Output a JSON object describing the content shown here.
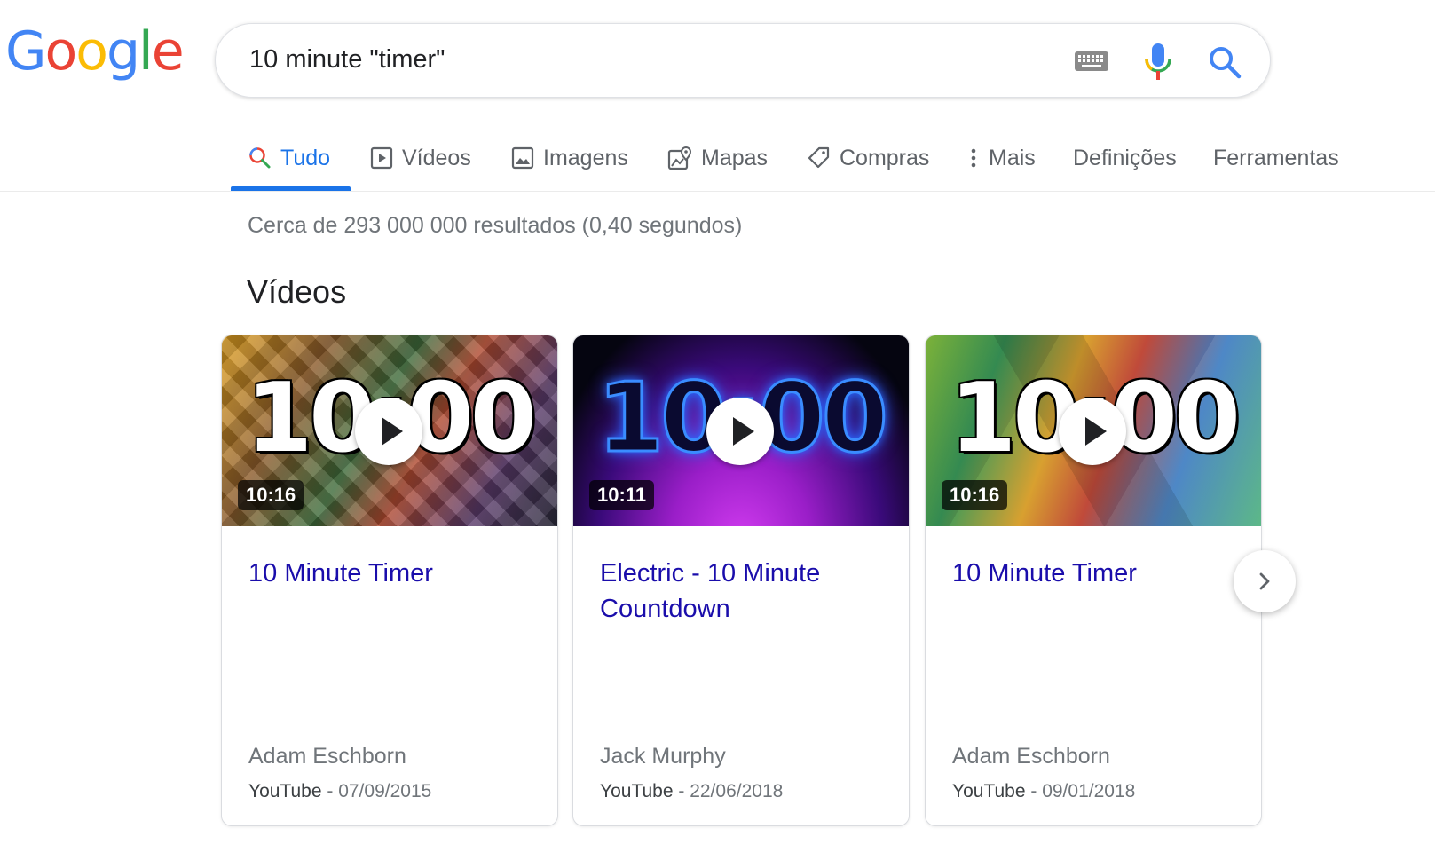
{
  "logo": {
    "letters": [
      "G",
      "o",
      "o",
      "g",
      "l",
      "e"
    ],
    "colors": [
      "#4285f4",
      "#ea4335",
      "#fbbc05",
      "#4285f4",
      "#34a853",
      "#ea4335"
    ]
  },
  "search": {
    "query": "10 minute \"timer\"",
    "icons": [
      "keyboard-icon",
      "mic-icon",
      "search-icon"
    ]
  },
  "tabs": [
    {
      "label": "Tudo",
      "icon": "search-icon",
      "active": true
    },
    {
      "label": "Vídeos",
      "icon": "play-icon"
    },
    {
      "label": "Imagens",
      "icon": "image-icon"
    },
    {
      "label": "Mapas",
      "icon": "map-icon"
    },
    {
      "label": "Compras",
      "icon": "tag-icon"
    },
    {
      "label": "Mais",
      "icon": "more-vert-icon"
    },
    {
      "label": "Definições"
    },
    {
      "label": "Ferramentas"
    }
  ],
  "result_stats": "Cerca de 293 000 000 resultados (0,40 segundos)",
  "videos_section": {
    "title": "Vídeos",
    "cards": [
      {
        "thumb_text": "10:00",
        "duration": "10:16",
        "title": "10 Minute Timer",
        "author": "Adam Eschborn",
        "source": "YouTube",
        "date": "07/09/2015"
      },
      {
        "thumb_text": "10:00",
        "duration": "10:11",
        "title": "Electric - 10 Minute Countdown",
        "author": "Jack Murphy",
        "source": "YouTube",
        "date": "22/06/2018"
      },
      {
        "thumb_text": "10:00",
        "duration": "10:16",
        "title": "10 Minute Timer",
        "author": "Adam Eschborn",
        "source": "YouTube",
        "date": "09/01/2018"
      }
    ],
    "separator": " - "
  },
  "colors": {
    "link": "#1a0dab",
    "accent": "#1a73e8",
    "muted": "#70757a"
  }
}
